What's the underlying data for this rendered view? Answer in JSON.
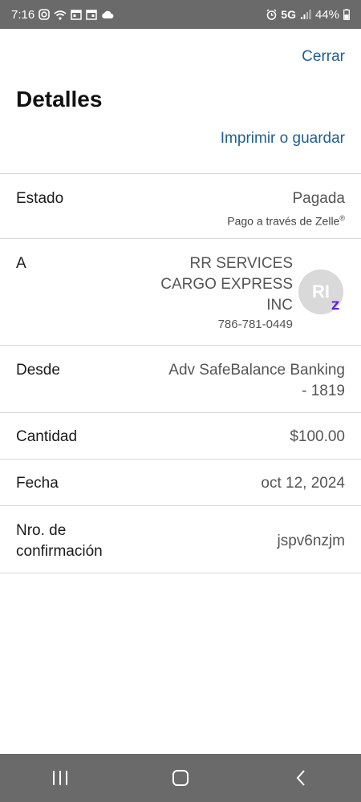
{
  "status_bar": {
    "time": "7:16",
    "network": "5G",
    "battery": "44%"
  },
  "header": {
    "close_label": "Cerrar",
    "title": "Detalles",
    "print_label": "Imprimir o guardar"
  },
  "details": {
    "status": {
      "label": "Estado",
      "value": "Pagada",
      "sub": "Pago a través de Zelle",
      "sub_mark": "®"
    },
    "to": {
      "label": "A",
      "name_line1": "RR SERVICES",
      "name_line2": "CARGO EXPRESS",
      "name_line3": "INC",
      "phone": "786-781-0449",
      "avatar_initials": "RI",
      "badge": "Z"
    },
    "from": {
      "label": "Desde",
      "value_line1": "Adv SafeBalance Banking",
      "value_line2": "- 1819"
    },
    "amount": {
      "label": "Cantidad",
      "value": "$100.00"
    },
    "date": {
      "label": "Fecha",
      "value": "oct 12, 2024"
    },
    "confirmation": {
      "label_line1": "Nro. de",
      "label_line2": "confirmación",
      "value": "jspv6nzjm"
    }
  },
  "colors": {
    "link": "#1f5f93",
    "zelle": "#6d1ed4",
    "system_bar": "#6a6a6a"
  }
}
